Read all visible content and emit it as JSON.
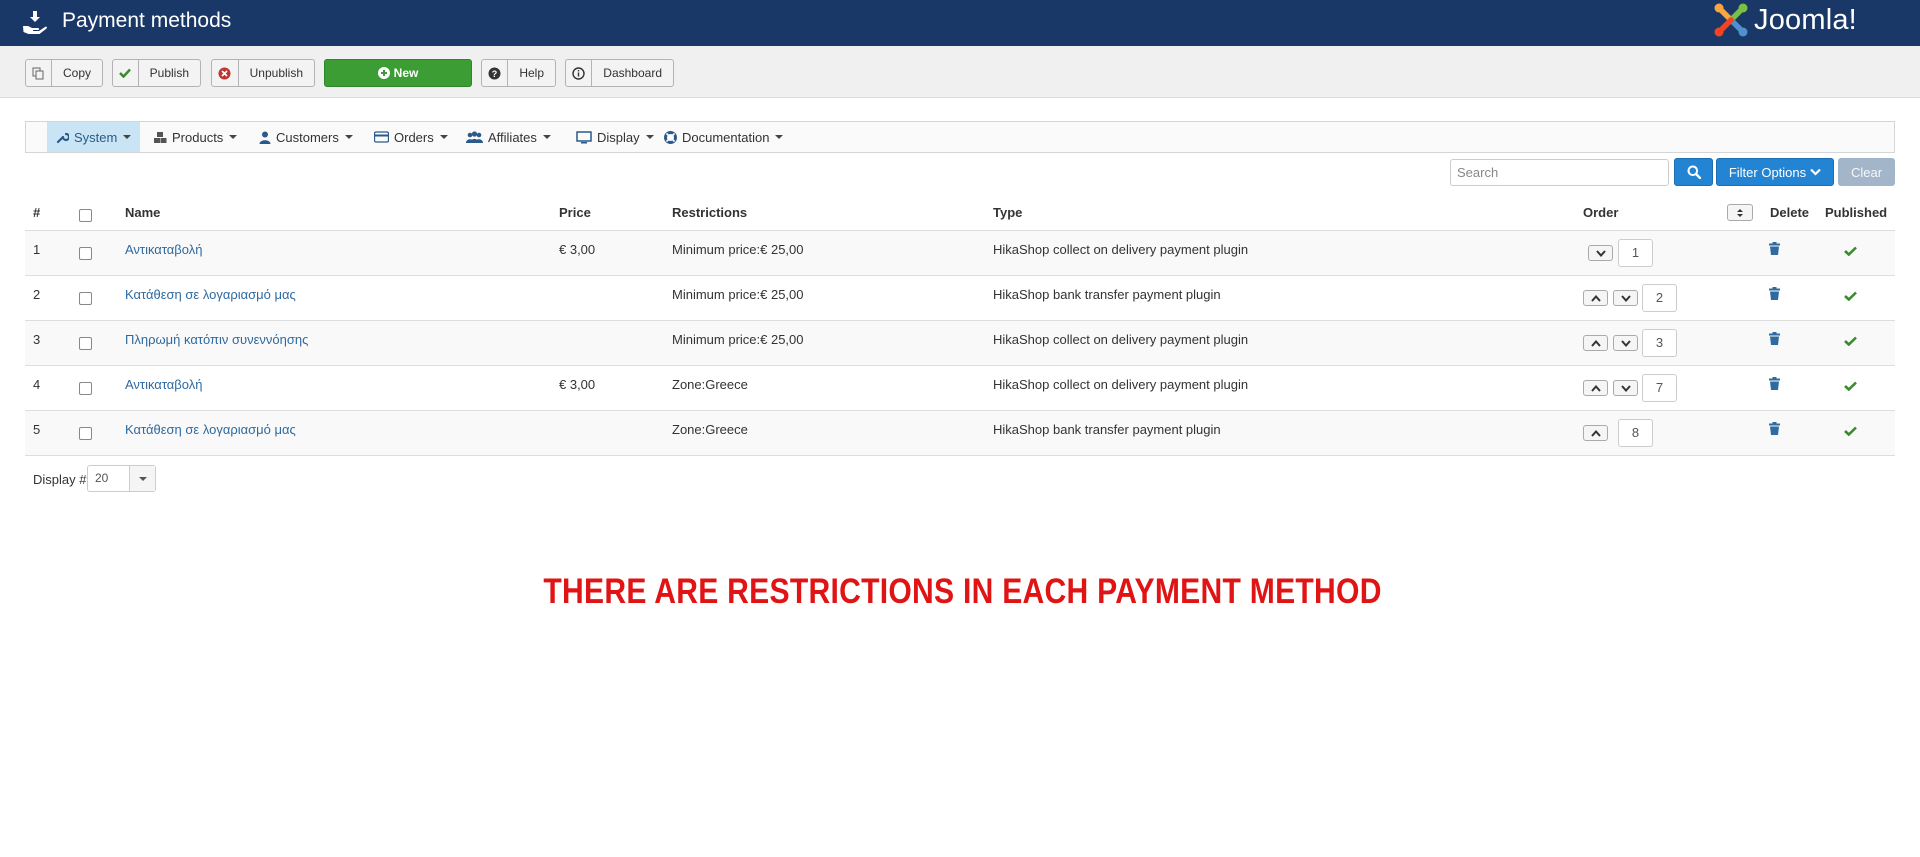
{
  "header": {
    "title": "Payment methods",
    "logo_text": "Joomla!"
  },
  "toolbar": {
    "copy": "Copy",
    "publish": "Publish",
    "unpublish": "Unpublish",
    "new": "New",
    "help": "Help",
    "dashboard": "Dashboard"
  },
  "menu": {
    "items": [
      "System",
      "Products",
      "Customers",
      "Orders",
      "Affiliates",
      "Display",
      "Documentation"
    ]
  },
  "search": {
    "placeholder": "Search",
    "filter_label": "Filter Options",
    "clear_label": "Clear"
  },
  "table": {
    "headers": {
      "num": "#",
      "name": "Name",
      "price": "Price",
      "restrictions": "Restrictions",
      "type": "Type",
      "order": "Order",
      "delete": "Delete",
      "published": "Published"
    },
    "rows": [
      {
        "num": "1",
        "name": "Αντικαταβολή",
        "price": "€ 3,00",
        "restrictions": "Minimum price:€ 25,00",
        "type": "HikaShop collect on delivery payment plugin",
        "order": "1",
        "up": false,
        "down": true,
        "published": true
      },
      {
        "num": "2",
        "name": "Κατάθεση σε λογαριασμό μας",
        "price": "",
        "restrictions": "Minimum price:€ 25,00",
        "type": "HikaShop bank transfer payment plugin",
        "order": "2",
        "up": true,
        "down": true,
        "published": true
      },
      {
        "num": "3",
        "name": "Πληρωμή κατόπιν συνεννόησης",
        "price": "",
        "restrictions": "Minimum price:€ 25,00",
        "type": "HikaShop collect on delivery payment plugin",
        "order": "3",
        "up": true,
        "down": true,
        "published": true
      },
      {
        "num": "4",
        "name": "Αντικαταβολή",
        "price": "€ 3,00",
        "restrictions": "Zone:Greece",
        "type": "HikaShop collect on delivery payment plugin",
        "order": "7",
        "up": true,
        "down": true,
        "published": true
      },
      {
        "num": "5",
        "name": "Κατάθεση σε λογαριασμό μας",
        "price": "",
        "restrictions": "Zone:Greece",
        "type": "HikaShop bank transfer payment plugin",
        "order": "8",
        "up": true,
        "down": false,
        "published": true
      }
    ]
  },
  "pagination": {
    "display_label": "Display #",
    "display_value": "20"
  },
  "banner": "THERE ARE RESTRICTIONS IN EACH PAYMENT METHOD",
  "colors": {
    "header_bg": "#1a3867",
    "new_button": "#3c9d34",
    "primary": "#2384d3",
    "link": "#2f6aa0",
    "banner": "#e01414",
    "published_check": "#3a8a2e"
  }
}
